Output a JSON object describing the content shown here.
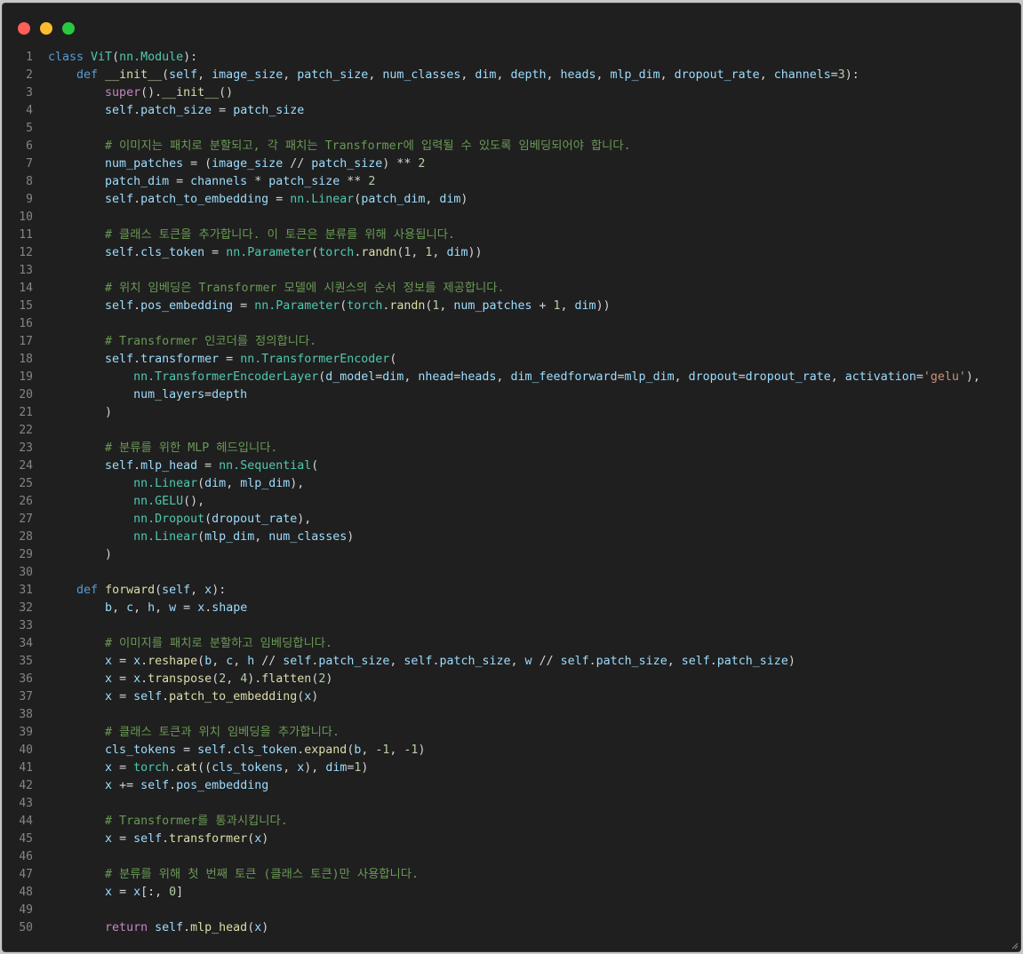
{
  "window": {
    "controls": [
      "close-icon",
      "minimize-icon",
      "maximize-icon"
    ],
    "colors": {
      "close": "#ff5f57",
      "minimize": "#febc2e",
      "maximize": "#28c840",
      "background": "#1f1f1f"
    }
  },
  "code": {
    "language": "python",
    "lines": [
      [
        [
          "kw",
          "class "
        ],
        [
          "cls",
          "ViT"
        ],
        [
          "op",
          "("
        ],
        [
          "cls",
          "nn.Module"
        ],
        [
          "op",
          "):"
        ]
      ],
      [
        [
          "op",
          "    "
        ],
        [
          "kw",
          "def "
        ],
        [
          "fn",
          "__init__"
        ],
        [
          "op",
          "("
        ],
        [
          "var",
          "self"
        ],
        [
          "op",
          ", "
        ],
        [
          "var",
          "image_size"
        ],
        [
          "op",
          ", "
        ],
        [
          "var",
          "patch_size"
        ],
        [
          "op",
          ", "
        ],
        [
          "var",
          "num_classes"
        ],
        [
          "op",
          ", "
        ],
        [
          "var",
          "dim"
        ],
        [
          "op",
          ", "
        ],
        [
          "var",
          "depth"
        ],
        [
          "op",
          ", "
        ],
        [
          "var",
          "heads"
        ],
        [
          "op",
          ", "
        ],
        [
          "var",
          "mlp_dim"
        ],
        [
          "op",
          ", "
        ],
        [
          "var",
          "dropout_rate"
        ],
        [
          "op",
          ", "
        ],
        [
          "var",
          "channels"
        ],
        [
          "op",
          "="
        ],
        [
          "num",
          "3"
        ],
        [
          "op",
          "):"
        ]
      ],
      [
        [
          "op",
          "        "
        ],
        [
          "kw2",
          "super"
        ],
        [
          "op",
          "()."
        ],
        [
          "fn",
          "__init__"
        ],
        [
          "op",
          "()"
        ]
      ],
      [
        [
          "op",
          "        "
        ],
        [
          "var",
          "self"
        ],
        [
          "op",
          "."
        ],
        [
          "var",
          "patch_size"
        ],
        [
          "op",
          " = "
        ],
        [
          "var",
          "patch_size"
        ]
      ],
      [],
      [
        [
          "op",
          "        "
        ],
        [
          "com",
          "# 이미지는 패치로 분할되고, 각 패치는 Transformer에 입력될 수 있도록 임베딩되어야 합니다."
        ]
      ],
      [
        [
          "op",
          "        "
        ],
        [
          "var",
          "num_patches"
        ],
        [
          "op",
          " = ("
        ],
        [
          "var",
          "image_size"
        ],
        [
          "op",
          " // "
        ],
        [
          "var",
          "patch_size"
        ],
        [
          "op",
          ") ** "
        ],
        [
          "num",
          "2"
        ]
      ],
      [
        [
          "op",
          "        "
        ],
        [
          "var",
          "patch_dim"
        ],
        [
          "op",
          " = "
        ],
        [
          "var",
          "channels"
        ],
        [
          "op",
          " * "
        ],
        [
          "var",
          "patch_size"
        ],
        [
          "op",
          " ** "
        ],
        [
          "num",
          "2"
        ]
      ],
      [
        [
          "op",
          "        "
        ],
        [
          "var",
          "self"
        ],
        [
          "op",
          "."
        ],
        [
          "var",
          "patch_to_embedding"
        ],
        [
          "op",
          " = "
        ],
        [
          "cls",
          "nn.Linear"
        ],
        [
          "op",
          "("
        ],
        [
          "var",
          "patch_dim"
        ],
        [
          "op",
          ", "
        ],
        [
          "var",
          "dim"
        ],
        [
          "op",
          ")"
        ]
      ],
      [],
      [
        [
          "op",
          "        "
        ],
        [
          "com",
          "# 클래스 토큰을 추가합니다. 이 토큰은 분류를 위해 사용됩니다."
        ]
      ],
      [
        [
          "op",
          "        "
        ],
        [
          "var",
          "self"
        ],
        [
          "op",
          "."
        ],
        [
          "var",
          "cls_token"
        ],
        [
          "op",
          " = "
        ],
        [
          "cls",
          "nn.Parameter"
        ],
        [
          "op",
          "("
        ],
        [
          "cls",
          "torch"
        ],
        [
          "op",
          "."
        ],
        [
          "fn",
          "randn"
        ],
        [
          "op",
          "("
        ],
        [
          "num",
          "1"
        ],
        [
          "op",
          ", "
        ],
        [
          "num",
          "1"
        ],
        [
          "op",
          ", "
        ],
        [
          "var",
          "dim"
        ],
        [
          "op",
          "))"
        ]
      ],
      [],
      [
        [
          "op",
          "        "
        ],
        [
          "com",
          "# 위치 임베딩은 Transformer 모델에 시퀀스의 순서 정보를 제공합니다."
        ]
      ],
      [
        [
          "op",
          "        "
        ],
        [
          "var",
          "self"
        ],
        [
          "op",
          "."
        ],
        [
          "var",
          "pos_embedding"
        ],
        [
          "op",
          " = "
        ],
        [
          "cls",
          "nn.Parameter"
        ],
        [
          "op",
          "("
        ],
        [
          "cls",
          "torch"
        ],
        [
          "op",
          "."
        ],
        [
          "fn",
          "randn"
        ],
        [
          "op",
          "("
        ],
        [
          "num",
          "1"
        ],
        [
          "op",
          ", "
        ],
        [
          "var",
          "num_patches"
        ],
        [
          "op",
          " + "
        ],
        [
          "num",
          "1"
        ],
        [
          "op",
          ", "
        ],
        [
          "var",
          "dim"
        ],
        [
          "op",
          "))"
        ]
      ],
      [],
      [
        [
          "op",
          "        "
        ],
        [
          "com",
          "# Transformer 인코더를 정의합니다."
        ]
      ],
      [
        [
          "op",
          "        "
        ],
        [
          "var",
          "self"
        ],
        [
          "op",
          "."
        ],
        [
          "var",
          "transformer"
        ],
        [
          "op",
          " = "
        ],
        [
          "cls",
          "nn.TransformerEncoder"
        ],
        [
          "op",
          "("
        ]
      ],
      [
        [
          "op",
          "            "
        ],
        [
          "cls",
          "nn.TransformerEncoderLayer"
        ],
        [
          "op",
          "("
        ],
        [
          "var",
          "d_model"
        ],
        [
          "op",
          "="
        ],
        [
          "var",
          "dim"
        ],
        [
          "op",
          ", "
        ],
        [
          "var",
          "nhead"
        ],
        [
          "op",
          "="
        ],
        [
          "var",
          "heads"
        ],
        [
          "op",
          ", "
        ],
        [
          "var",
          "dim_feedforward"
        ],
        [
          "op",
          "="
        ],
        [
          "var",
          "mlp_dim"
        ],
        [
          "op",
          ", "
        ],
        [
          "var",
          "dropout"
        ],
        [
          "op",
          "="
        ],
        [
          "var",
          "dropout_rate"
        ],
        [
          "op",
          ", "
        ],
        [
          "var",
          "activation"
        ],
        [
          "op",
          "="
        ],
        [
          "str",
          "'gelu'"
        ],
        [
          "op",
          "),"
        ]
      ],
      [
        [
          "op",
          "            "
        ],
        [
          "var",
          "num_layers"
        ],
        [
          "op",
          "="
        ],
        [
          "var",
          "depth"
        ]
      ],
      [
        [
          "op",
          "        )"
        ]
      ],
      [],
      [
        [
          "op",
          "        "
        ],
        [
          "com",
          "# 분류를 위한 MLP 헤드입니다."
        ]
      ],
      [
        [
          "op",
          "        "
        ],
        [
          "var",
          "self"
        ],
        [
          "op",
          "."
        ],
        [
          "var",
          "mlp_head"
        ],
        [
          "op",
          " = "
        ],
        [
          "cls",
          "nn.Sequential"
        ],
        [
          "op",
          "("
        ]
      ],
      [
        [
          "op",
          "            "
        ],
        [
          "cls",
          "nn.Linear"
        ],
        [
          "op",
          "("
        ],
        [
          "var",
          "dim"
        ],
        [
          "op",
          ", "
        ],
        [
          "var",
          "mlp_dim"
        ],
        [
          "op",
          "),"
        ]
      ],
      [
        [
          "op",
          "            "
        ],
        [
          "cls",
          "nn.GELU"
        ],
        [
          "op",
          "(),"
        ]
      ],
      [
        [
          "op",
          "            "
        ],
        [
          "cls",
          "nn.Dropout"
        ],
        [
          "op",
          "("
        ],
        [
          "var",
          "dropout_rate"
        ],
        [
          "op",
          "),"
        ]
      ],
      [
        [
          "op",
          "            "
        ],
        [
          "cls",
          "nn.Linear"
        ],
        [
          "op",
          "("
        ],
        [
          "var",
          "mlp_dim"
        ],
        [
          "op",
          ", "
        ],
        [
          "var",
          "num_classes"
        ],
        [
          "op",
          ")"
        ]
      ],
      [
        [
          "op",
          "        )"
        ]
      ],
      [],
      [
        [
          "op",
          "    "
        ],
        [
          "kw",
          "def "
        ],
        [
          "fn",
          "forward"
        ],
        [
          "op",
          "("
        ],
        [
          "var",
          "self"
        ],
        [
          "op",
          ", "
        ],
        [
          "var",
          "x"
        ],
        [
          "op",
          "):"
        ]
      ],
      [
        [
          "op",
          "        "
        ],
        [
          "var",
          "b"
        ],
        [
          "op",
          ", "
        ],
        [
          "var",
          "c"
        ],
        [
          "op",
          ", "
        ],
        [
          "var",
          "h"
        ],
        [
          "op",
          ", "
        ],
        [
          "var",
          "w"
        ],
        [
          "op",
          " = "
        ],
        [
          "var",
          "x"
        ],
        [
          "op",
          "."
        ],
        [
          "var",
          "shape"
        ]
      ],
      [],
      [
        [
          "op",
          "        "
        ],
        [
          "com",
          "# 이미지를 패치로 분할하고 임베딩합니다."
        ]
      ],
      [
        [
          "op",
          "        "
        ],
        [
          "var",
          "x"
        ],
        [
          "op",
          " = "
        ],
        [
          "var",
          "x"
        ],
        [
          "op",
          "."
        ],
        [
          "fn",
          "reshape"
        ],
        [
          "op",
          "("
        ],
        [
          "var",
          "b"
        ],
        [
          "op",
          ", "
        ],
        [
          "var",
          "c"
        ],
        [
          "op",
          ", "
        ],
        [
          "var",
          "h"
        ],
        [
          "op",
          " // "
        ],
        [
          "var",
          "self"
        ],
        [
          "op",
          "."
        ],
        [
          "var",
          "patch_size"
        ],
        [
          "op",
          ", "
        ],
        [
          "var",
          "self"
        ],
        [
          "op",
          "."
        ],
        [
          "var",
          "patch_size"
        ],
        [
          "op",
          ", "
        ],
        [
          "var",
          "w"
        ],
        [
          "op",
          " // "
        ],
        [
          "var",
          "self"
        ],
        [
          "op",
          "."
        ],
        [
          "var",
          "patch_size"
        ],
        [
          "op",
          ", "
        ],
        [
          "var",
          "self"
        ],
        [
          "op",
          "."
        ],
        [
          "var",
          "patch_size"
        ],
        [
          "op",
          ")"
        ]
      ],
      [
        [
          "op",
          "        "
        ],
        [
          "var",
          "x"
        ],
        [
          "op",
          " = "
        ],
        [
          "var",
          "x"
        ],
        [
          "op",
          "."
        ],
        [
          "fn",
          "transpose"
        ],
        [
          "op",
          "("
        ],
        [
          "num",
          "2"
        ],
        [
          "op",
          ", "
        ],
        [
          "num",
          "4"
        ],
        [
          "op",
          ")."
        ],
        [
          "fn",
          "flatten"
        ],
        [
          "op",
          "("
        ],
        [
          "num",
          "2"
        ],
        [
          "op",
          ")"
        ]
      ],
      [
        [
          "op",
          "        "
        ],
        [
          "var",
          "x"
        ],
        [
          "op",
          " = "
        ],
        [
          "var",
          "self"
        ],
        [
          "op",
          "."
        ],
        [
          "fn",
          "patch_to_embedding"
        ],
        [
          "op",
          "("
        ],
        [
          "var",
          "x"
        ],
        [
          "op",
          ")"
        ]
      ],
      [],
      [
        [
          "op",
          "        "
        ],
        [
          "com",
          "# 클래스 토큰과 위치 임베딩을 추가합니다."
        ]
      ],
      [
        [
          "op",
          "        "
        ],
        [
          "var",
          "cls_tokens"
        ],
        [
          "op",
          " = "
        ],
        [
          "var",
          "self"
        ],
        [
          "op",
          "."
        ],
        [
          "var",
          "cls_token"
        ],
        [
          "op",
          "."
        ],
        [
          "fn",
          "expand"
        ],
        [
          "op",
          "("
        ],
        [
          "var",
          "b"
        ],
        [
          "op",
          ", -"
        ],
        [
          "num",
          "1"
        ],
        [
          "op",
          ", -"
        ],
        [
          "num",
          "1"
        ],
        [
          "op",
          ")"
        ]
      ],
      [
        [
          "op",
          "        "
        ],
        [
          "var",
          "x"
        ],
        [
          "op",
          " = "
        ],
        [
          "cls",
          "torch"
        ],
        [
          "op",
          "."
        ],
        [
          "fn",
          "cat"
        ],
        [
          "op",
          "(("
        ],
        [
          "var",
          "cls_tokens"
        ],
        [
          "op",
          ", "
        ],
        [
          "var",
          "x"
        ],
        [
          "op",
          "), "
        ],
        [
          "var",
          "dim"
        ],
        [
          "op",
          "="
        ],
        [
          "num",
          "1"
        ],
        [
          "op",
          ")"
        ]
      ],
      [
        [
          "op",
          "        "
        ],
        [
          "var",
          "x"
        ],
        [
          "op",
          " += "
        ],
        [
          "var",
          "self"
        ],
        [
          "op",
          "."
        ],
        [
          "var",
          "pos_embedding"
        ]
      ],
      [],
      [
        [
          "op",
          "        "
        ],
        [
          "com",
          "# Transformer를 통과시킵니다."
        ]
      ],
      [
        [
          "op",
          "        "
        ],
        [
          "var",
          "x"
        ],
        [
          "op",
          " = "
        ],
        [
          "var",
          "self"
        ],
        [
          "op",
          "."
        ],
        [
          "fn",
          "transformer"
        ],
        [
          "op",
          "("
        ],
        [
          "var",
          "x"
        ],
        [
          "op",
          ")"
        ]
      ],
      [],
      [
        [
          "op",
          "        "
        ],
        [
          "com",
          "# 분류를 위해 첫 번째 토큰 (클래스 토큰)만 사용합니다."
        ]
      ],
      [
        [
          "op",
          "        "
        ],
        [
          "var",
          "x"
        ],
        [
          "op",
          " = "
        ],
        [
          "var",
          "x"
        ],
        [
          "op",
          "[:, "
        ],
        [
          "num",
          "0"
        ],
        [
          "op",
          "]"
        ]
      ],
      [],
      [
        [
          "op",
          "        "
        ],
        [
          "kw2",
          "return "
        ],
        [
          "var",
          "self"
        ],
        [
          "op",
          "."
        ],
        [
          "fn",
          "mlp_head"
        ],
        [
          "op",
          "("
        ],
        [
          "var",
          "x"
        ],
        [
          "op",
          ")"
        ]
      ]
    ]
  }
}
